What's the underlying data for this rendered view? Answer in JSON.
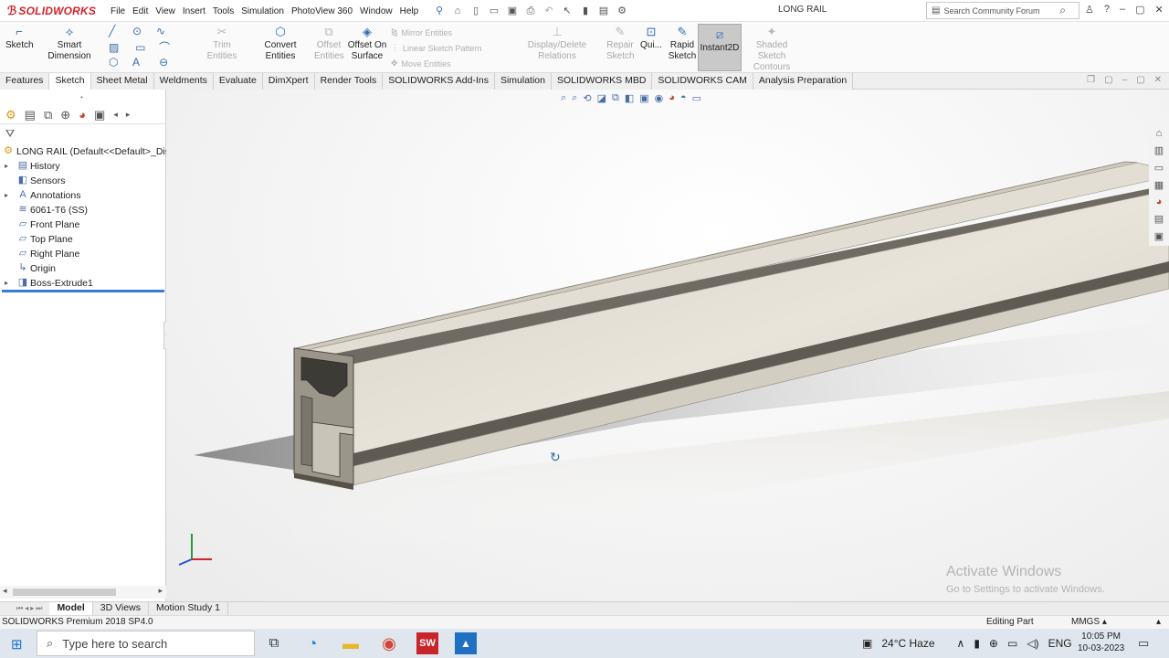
{
  "titlebar": {
    "brand": "SOLIDWORKS",
    "menu": [
      "File",
      "Edit",
      "View",
      "Insert",
      "Tools",
      "Simulation",
      "PhotoView 360",
      "Window",
      "Help"
    ],
    "document_title": "LONG RAIL",
    "search_placeholder": "Search Community Forum"
  },
  "command_manager": {
    "sketch": "Sketch",
    "smart_dimension": "Smart Dimension",
    "trim_entities": "Trim Entities",
    "convert_entities": "Convert Entities",
    "offset_entities": "Offset Entities",
    "offset_on_surface": "Offset On Surface",
    "mirror_entities": "Mirror Entities",
    "linear_sketch_pattern": "Linear Sketch Pattern",
    "move_entities": "Move Entities",
    "display_delete_relations": "Display/Delete Relations",
    "repair_sketch": "Repair Sketch",
    "quick_snaps": "Qui...",
    "rapid_sketch": "Rapid Sketch",
    "instant2d": "Instant2D",
    "shaded_sketch_contours": "Shaded Sketch Contours"
  },
  "tabs": [
    "Features",
    "Sketch",
    "Sheet Metal",
    "Weldments",
    "Evaluate",
    "DimXpert",
    "Render Tools",
    "SOLIDWORKS Add-Ins",
    "Simulation",
    "SOLIDWORKS MBD",
    "SOLIDWORKS CAM",
    "Analysis Preparation"
  ],
  "active_tab": "Sketch",
  "feature_tree": {
    "root": "LONG RAIL  (Default<<Default>_Dis",
    "items": [
      {
        "label": "History",
        "expandable": true,
        "icon": "history-icon"
      },
      {
        "label": "Sensors",
        "expandable": false,
        "icon": "sensor-icon"
      },
      {
        "label": "Annotations",
        "expandable": true,
        "icon": "annotations-icon"
      },
      {
        "label": "6061-T6 (SS)",
        "expandable": false,
        "icon": "material-icon"
      },
      {
        "label": "Front Plane",
        "expandable": false,
        "icon": "plane-icon"
      },
      {
        "label": "Top Plane",
        "expandable": false,
        "icon": "plane-icon"
      },
      {
        "label": "Right Plane",
        "expandable": false,
        "icon": "plane-icon"
      },
      {
        "label": "Origin",
        "expandable": false,
        "icon": "origin-icon"
      },
      {
        "label": "Boss-Extrude1",
        "expandable": true,
        "icon": "extrude-icon"
      }
    ]
  },
  "viewport": {
    "watermark_title": "Activate Windows",
    "watermark_sub": "Go to Settings to activate Windows."
  },
  "bottom_tabs": [
    "Model",
    "3D Views",
    "Motion Study 1"
  ],
  "active_bottom_tab": "Model",
  "status": {
    "left": "SOLIDWORKS Premium 2018 SP4.0",
    "mode": "Editing Part",
    "units": "MMGS"
  },
  "taskbar": {
    "search_placeholder": "Type here to search",
    "weather": "24°C  Haze",
    "language": "ENG",
    "time": "10:05 PM",
    "date": "10-03-2023"
  },
  "colors": {
    "brand_red": "#d2232a",
    "accent_blue": "#2a6fb4",
    "rail_face": "#ded9cc",
    "rail_end": "#8f8a7e"
  }
}
